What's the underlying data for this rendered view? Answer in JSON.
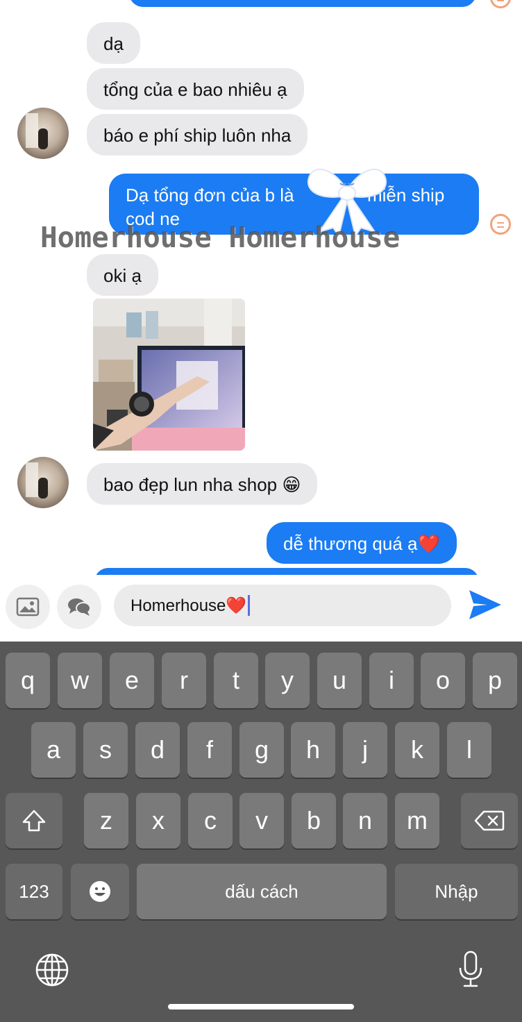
{
  "messages": [
    {
      "id": "m1",
      "from": "them",
      "text": "dạ"
    },
    {
      "id": "m2",
      "from": "them",
      "text": "tổng của e bao nhiêu ạ"
    },
    {
      "id": "m3",
      "from": "them",
      "text": "báo e phí ship luôn nha"
    },
    {
      "id": "m4",
      "from": "me",
      "line1": "Dạ tổng đơn của b là",
      "line1_end": "miễn ship",
      "line2": "cod ne"
    },
    {
      "id": "m5",
      "from": "them",
      "text": "oki ạ"
    },
    {
      "id": "m6",
      "from": "them",
      "text": "bao đẹp lun nha shop 😁"
    },
    {
      "id": "m7",
      "from": "me",
      "text": "dễ thương quá ạ❤️"
    }
  ],
  "watermark": "Homerhouse Homerhouse",
  "composer": {
    "text": "Homerhouse❤️",
    "photo_icon": "image-icon",
    "chat_icon": "chat-bubbles-icon",
    "send_icon": "send-icon"
  },
  "keyboard": {
    "row1": [
      "q",
      "w",
      "e",
      "r",
      "t",
      "y",
      "u",
      "i",
      "o",
      "p"
    ],
    "row2": [
      "a",
      "s",
      "d",
      "f",
      "g",
      "h",
      "j",
      "k",
      "l"
    ],
    "row3": [
      "z",
      "x",
      "c",
      "v",
      "b",
      "n",
      "m"
    ],
    "numbers": "123",
    "space": "dấu cách",
    "return": "Nhập",
    "shift_icon": "shift-icon",
    "delete_icon": "backspace-icon",
    "emoji_icon": "emoji-icon",
    "globe_icon": "globe-icon",
    "mic_icon": "microphone-icon"
  },
  "colors": {
    "sent_bubble": "#1b7cf3",
    "received_bubble": "#e9e9eb",
    "keyboard_bg": "#575757",
    "key": "#7a7a7a",
    "seen_icon": "#f2a27a"
  }
}
